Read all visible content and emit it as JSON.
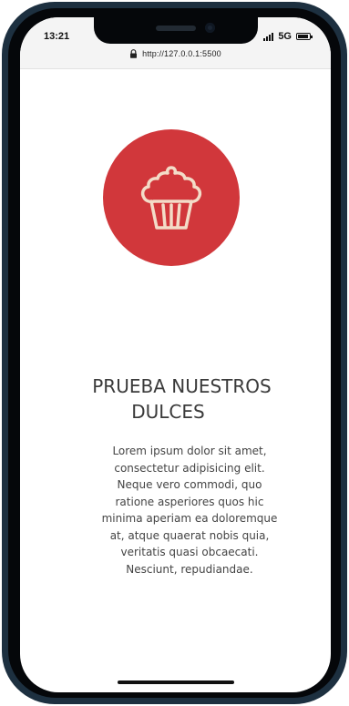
{
  "status_bar": {
    "time": "13:21",
    "network": "5G"
  },
  "browser": {
    "url": "http://127.0.0.1:5500"
  },
  "hero": {
    "icon": "cupcake-icon",
    "circle_color": "#d1373b",
    "heading_line1": "PRUEBA NUESTROS",
    "heading_line2": "DULCES",
    "paragraph_lines": [
      "Lorem ipsum dolor sit amet,",
      "consectetur adipisicing elit.",
      "Neque vero commodi, quo",
      "ratione asperiores quos hic",
      "minima aperiam ea doloremque",
      "at, atque quaerat nobis quia,",
      "veritatis quasi obcaecati.",
      "Nesciunt, repudiandae."
    ]
  },
  "colors": {
    "accent": "#d1373b",
    "icon_stroke": "#f3dcc8",
    "frame": "#1d3040"
  }
}
